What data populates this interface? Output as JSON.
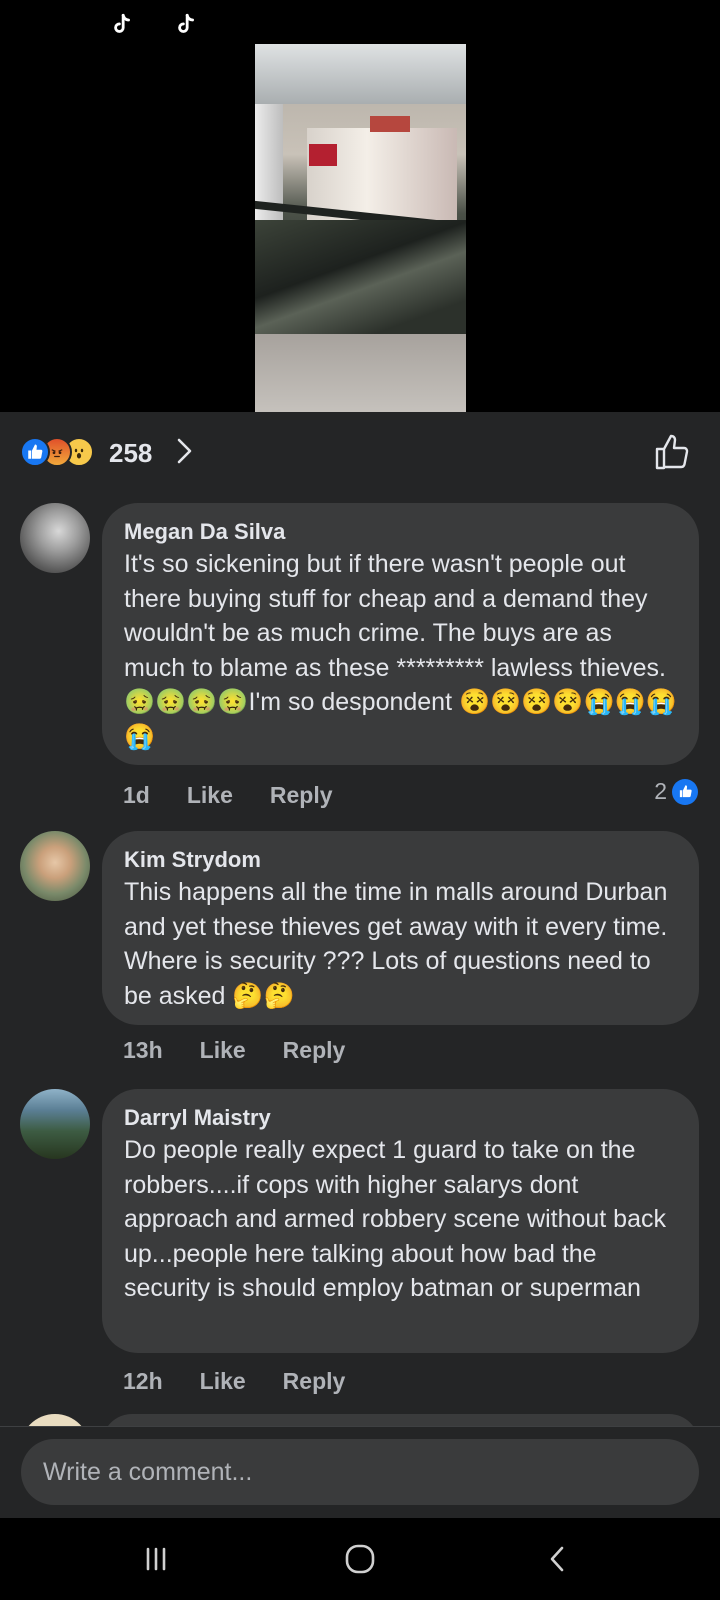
{
  "post": {
    "reaction_count": "258",
    "reaction_types": [
      "like-icon",
      "angry-icon",
      "wow-icon"
    ]
  },
  "comments": [
    {
      "author": "Megan Da Silva",
      "text": "It's so sickening but if there wasn't people out there buying stuff for cheap and a demand they wouldn't be as much crime. The buys are as much to blame as these ********* lawless thieves. 🤢🤢🤢🤢I'm so despondent 😵😵😵😵😭😭😭😭",
      "time": "1d",
      "like_label": "Like",
      "reply_label": "Reply",
      "likes": "2"
    },
    {
      "author": "Kim Strydom",
      "text": "This happens all the time in malls around Durban  and yet these thieves get away with it every time. Where is security ??? Lots of questions need to be asked 🤔🤔",
      "time": "13h",
      "like_label": "Like",
      "reply_label": "Reply"
    },
    {
      "author": "Darryl Maistry",
      "text": "Do people really expect 1 guard to take on the robbers....if cops with higher salarys dont approach and armed robbery scene without back up...people here talking about how bad the security is should employ batman or superman",
      "time": "12h",
      "like_label": "Like",
      "reply_label": "Reply"
    }
  ],
  "composer": {
    "placeholder": "Write a comment..."
  },
  "colors": {
    "background": "#242526",
    "bubble": "#3a3b3c",
    "accent_blue": "#1877f2",
    "muted_text": "#b0b3b8"
  }
}
